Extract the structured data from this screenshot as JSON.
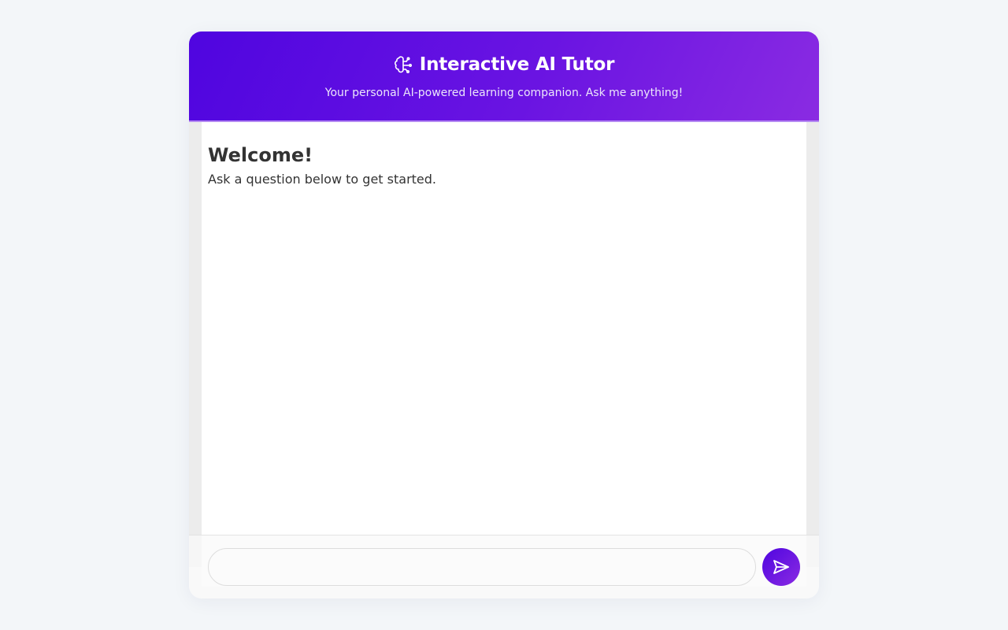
{
  "header": {
    "icon": "brain-icon",
    "title": "Interactive AI Tutor",
    "subtitle": "Your personal AI-powered learning companion. Ask me anything!"
  },
  "chat": {
    "welcome_title": "Welcome!",
    "welcome_text": "Ask a question below to get started."
  },
  "input": {
    "value": "",
    "placeholder": ""
  },
  "send_button": {
    "icon": "send-icon"
  },
  "colors": {
    "background": "#f3f6f9",
    "header_gradient_start": "#4f05e0",
    "header_gradient_end": "#8a2be2",
    "text": "#333333"
  }
}
